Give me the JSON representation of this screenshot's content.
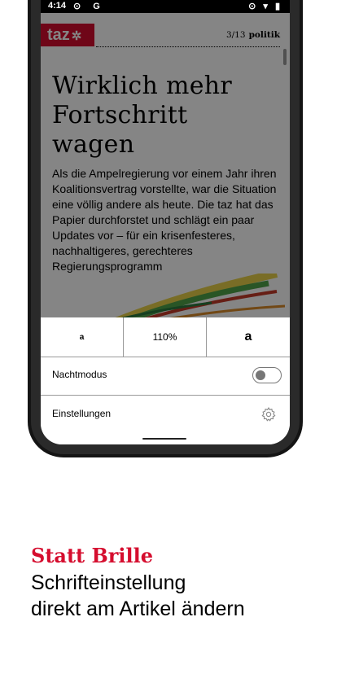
{
  "status_bar": {
    "time": "4:14",
    "left_icons": "⊙ G",
    "right_icons": "⊙ ▾ ▮"
  },
  "article": {
    "logo_text": "taz",
    "page_info": "3/13",
    "section": "politik",
    "headline_lines": [
      "Wirklich mehr",
      "Fortschritt",
      "wagen"
    ],
    "lead": "Als die Ampelregierung vor einem Jahr ihren Koalitionsvertrag vorstellte, war die Situation eine völlig andere als heute. Die taz hat das Papier durchforstet und schlägt ein paar Updates vor – für ein krisenfesteres, nachhaltigeres, gerechteres Regierungsprogramm"
  },
  "font_panel": {
    "decrease_label": "a",
    "zoom_label": "110%",
    "increase_label": "a",
    "night_mode_label": "Nachtmodus",
    "night_mode_on": false,
    "settings_label": "Einstellungen"
  },
  "promo": {
    "headline": "Statt Brille",
    "subline_1": "Schrifteinstellung",
    "subline_2": "direkt am Artikel ändern"
  },
  "colors": {
    "brand_red": "#d50d2e"
  },
  "icons": {
    "logo_mark": "taz-paw-icon",
    "settings": "gear-icon"
  }
}
